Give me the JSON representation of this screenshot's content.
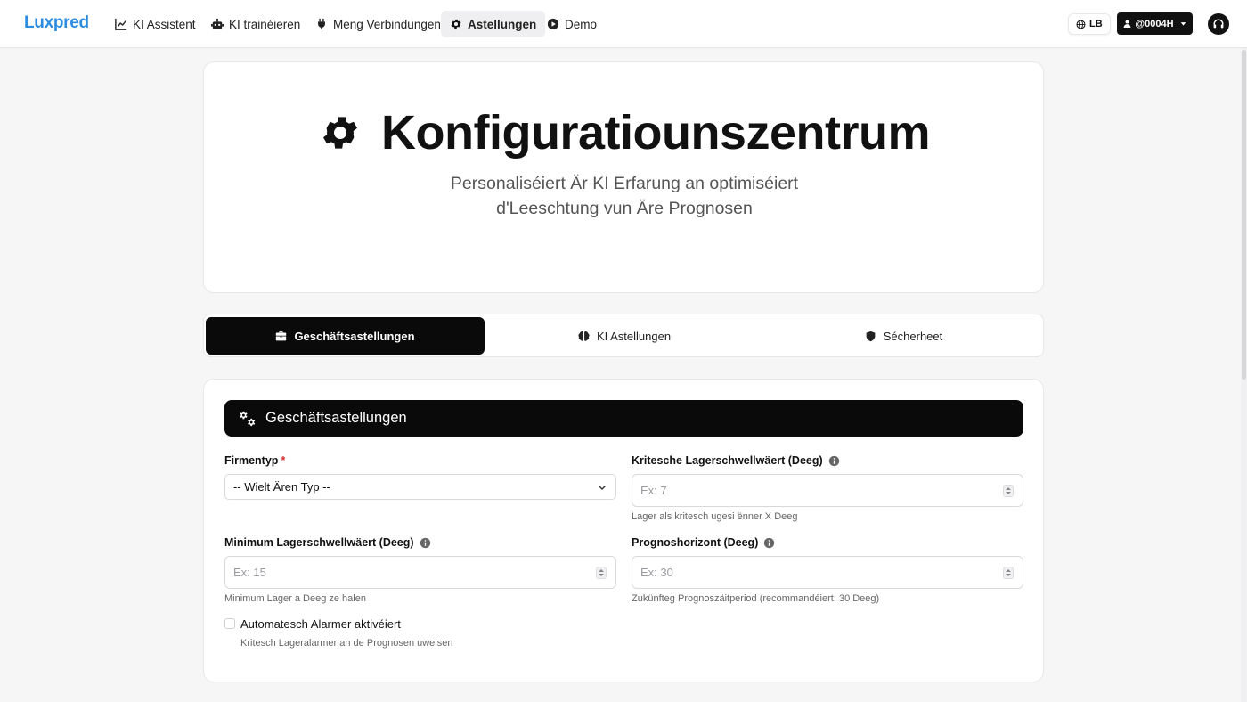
{
  "brand": {
    "logo": "Luxpred",
    "logo_color": "#2c8de0"
  },
  "nav": {
    "items": [
      {
        "label": "KI Assistent",
        "icon": "chart-line-icon"
      },
      {
        "label": "KI trainéieren",
        "icon": "robot-icon"
      },
      {
        "label": "Meng Verbindungen",
        "icon": "plug-icon"
      },
      {
        "label": "Astellungen",
        "icon": "gear-icon",
        "active": true
      },
      {
        "label": "Demo",
        "icon": "play-circle-icon"
      }
    ],
    "language": "LB",
    "user": "@0004H"
  },
  "hero": {
    "title": "Konfiguratiounszentrum",
    "subtitle_line1": "Personaliséiert Är KI Erfarung an optimiséiert",
    "subtitle_line2": "d'Leeschtung vun Äre Prognosen"
  },
  "tabs": [
    {
      "label": "Geschäftsastellungen",
      "icon": "briefcase-icon",
      "active": true
    },
    {
      "label": "KI Astellungen",
      "icon": "brain-icon"
    },
    {
      "label": "Sécherheet",
      "icon": "shield-icon"
    }
  ],
  "card": {
    "title": "Geschäftsastellungen",
    "fields": {
      "company_type": {
        "label": "Firmentyp",
        "required_mark": "*",
        "value": "-- Wielt Ären Typ --"
      },
      "critical_threshold": {
        "label": "Kritesche Lagerschwellwäert (Deeg)",
        "placeholder": "Ex: 7",
        "help": "Lager als kritesch ugesi ënner X Deeg"
      },
      "min_threshold": {
        "label": "Minimum Lagerschwellwäert (Deeg)",
        "placeholder": "Ex: 15",
        "help": "Minimum Lager a Deeg ze halen"
      },
      "forecast_horizon": {
        "label": "Prognoshorizont (Deeg)",
        "placeholder": "Ex: 30",
        "help": "Zukünfteg Prognoszäitperiod (recommandéiert: 30 Deeg)"
      },
      "auto_alerts": {
        "label": "Automatesch Alarmer aktivéiert",
        "help": "Kritesch Lageralarmer an de Prognosen uweisen",
        "checked": false
      }
    }
  }
}
